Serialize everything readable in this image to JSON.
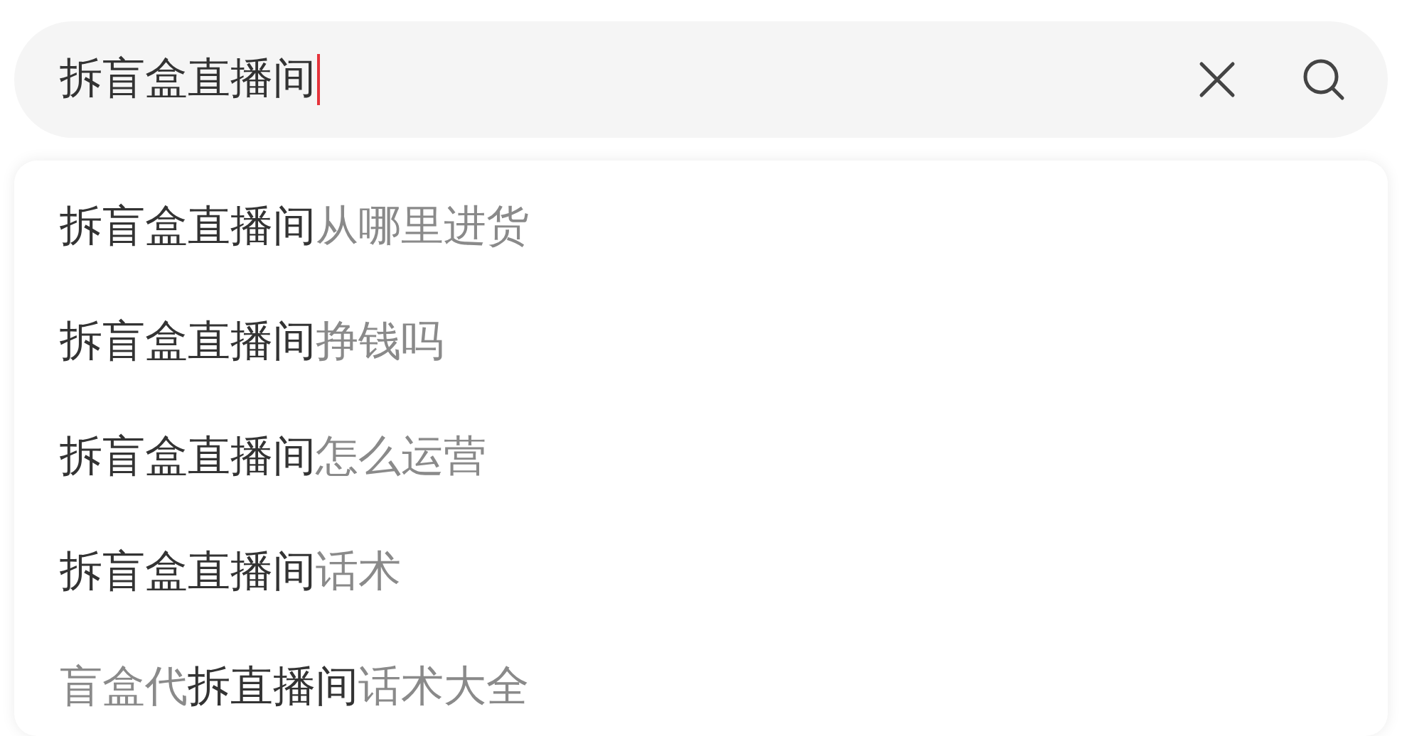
{
  "search": {
    "value": "拆盲盒直播间"
  },
  "suggestions": [
    {
      "parts": [
        {
          "text": "拆盲盒直播间",
          "match": true
        },
        {
          "text": "从哪里进货",
          "match": false
        }
      ]
    },
    {
      "parts": [
        {
          "text": "拆盲盒直播间",
          "match": true
        },
        {
          "text": "挣钱吗",
          "match": false
        }
      ]
    },
    {
      "parts": [
        {
          "text": "拆盲盒直播间",
          "match": true
        },
        {
          "text": "怎么运营",
          "match": false
        }
      ]
    },
    {
      "parts": [
        {
          "text": "拆盲盒直播间",
          "match": true
        },
        {
          "text": "话术",
          "match": false
        }
      ]
    },
    {
      "parts": [
        {
          "text": "盲盒代",
          "match": false
        },
        {
          "text": "拆直播间",
          "match": true
        },
        {
          "text": "话术大全",
          "match": false
        }
      ]
    }
  ]
}
